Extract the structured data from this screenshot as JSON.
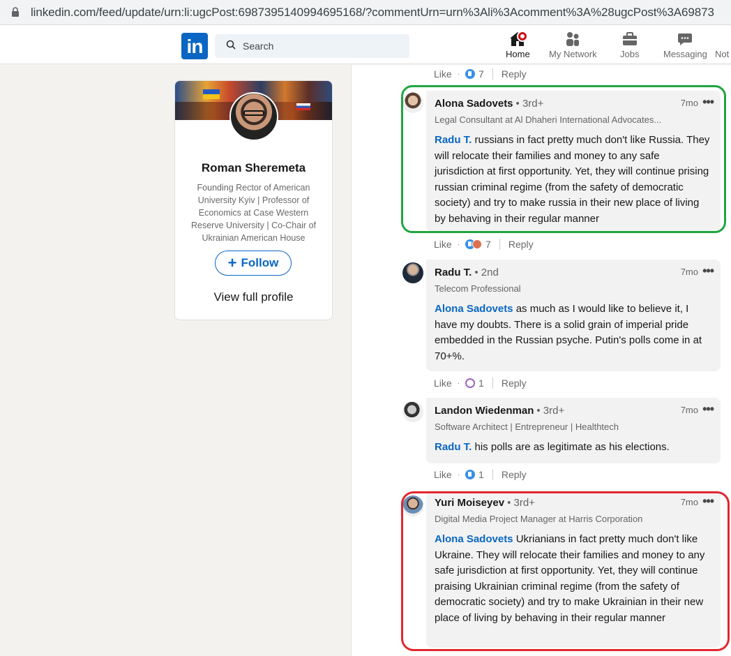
{
  "browser": {
    "url": "linkedin.com/feed/update/urn:li:ugcPost:6987395140994695168/?commentUrn=urn%3Ali%3Acomment%3A%28ugcPost%3A69873"
  },
  "nav": {
    "logo": "in",
    "search_placeholder": "Search",
    "items": [
      {
        "label": "Home",
        "icon": "home-icon"
      },
      {
        "label": "My Network",
        "icon": "people-icon"
      },
      {
        "label": "Jobs",
        "icon": "briefcase-icon"
      },
      {
        "label": "Messaging",
        "icon": "chat-icon"
      },
      {
        "label": "Not"
      }
    ]
  },
  "profile": {
    "name": "Roman Sheremeta",
    "headline": "Founding Rector of American University Kyiv | Professor of Economics at Case Western Reserve University | Co-Chair of Ukrainian American House",
    "follow_label": "Follow",
    "view_profile_label": "View full profile"
  },
  "labels": {
    "like": "Like",
    "reply": "Reply",
    "dot": "·"
  },
  "top_actions": {
    "reaction_count": "7"
  },
  "comments": [
    {
      "name": "Alona Sadovets",
      "degree": "• 3rd+",
      "subtitle": "Legal Consultant at Al Dhaheri International Advocates...",
      "time": "7mo",
      "mention": "Radu T.",
      "text": " russians in fact pretty much don't like Russia. They will relocate their families and money to any safe jurisdiction at first opportunity. Yet, they will continue prising russian criminal regime (from the safety of democratic society) and try to make russia in their new place of living by behaving in their regular manner",
      "reaction_count": "7"
    },
    {
      "name": "Radu T.",
      "degree": "• 2nd",
      "subtitle": "Telecom Professional",
      "time": "7mo",
      "mention": "Alona Sadovets",
      "text": " as much as I would like to believe it, I have my doubts. There is a solid grain of imperial pride embedded in the Russian psyche. Putin's polls come in at 70+%.",
      "reaction_count": "1"
    },
    {
      "name": "Landon Wiedenman",
      "degree": "• 3rd+",
      "subtitle": "Software Architect | Entrepreneur | Healthtech",
      "time": "7mo",
      "mention": "Radu T.",
      "text": " his polls are as legitimate as his elections.",
      "reaction_count": "1"
    },
    {
      "name": "Yuri Moiseyev",
      "degree": "• 3rd+",
      "subtitle": "Digital Media Project Manager at Harris Corporation",
      "time": "7mo",
      "mention": "Alona Sadovets",
      "text": " Ukrianians in fact pretty much don't like Ukraine. They will relocate their families and money to any safe jurisdiction at first opportunity. Yet, they will continue praising Ukrainian criminal regime (from the safety of democratic society) and try to make Ukrainian in their new place of living by behaving in their regular manner"
    }
  ]
}
